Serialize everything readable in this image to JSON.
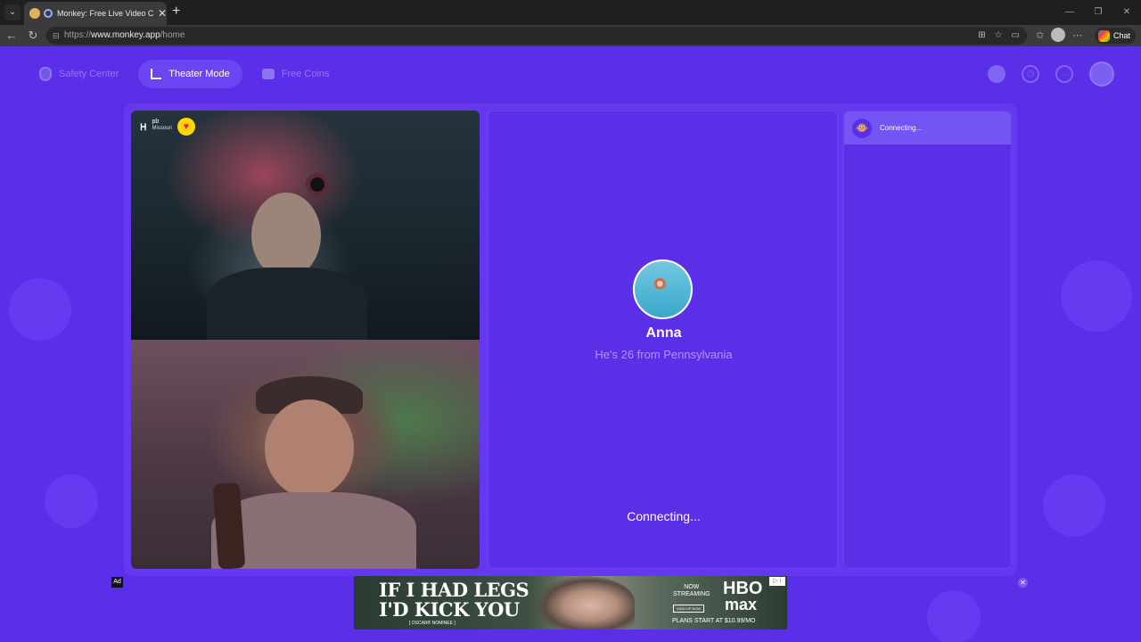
{
  "browser": {
    "tab_title": "Monkey: Free Live Video Chat",
    "url_scheme": "https://",
    "url_host": "www.monkey.app",
    "url_path": "/home",
    "chat_label": "Chat"
  },
  "nav": {
    "safety_center": "Safety Center",
    "theater_mode": "Theater Mode",
    "free_coins": "Free Coins"
  },
  "camera_user": {
    "logo": "ᕼ",
    "name": "pb",
    "location": "Missouri"
  },
  "match": {
    "name": "Anna",
    "info": "He's 26 from Pennsylvania",
    "status": "Connecting..."
  },
  "queue": {
    "status": "Connecting..."
  },
  "ad": {
    "label": "Ad",
    "headline_1": "IF I HAD LEGS",
    "headline_2": "I'D KICK YOU",
    "sub": "[ OSCAR® NOMINEE ]",
    "now_1": "NOW",
    "now_2": "STREAMING",
    "signup": "SIGN UP NOW",
    "brand_1": "HBO",
    "brand_2": "max",
    "plans": "PLANS START AT $10.99/MO"
  },
  "colors": {
    "app_bg": "#5b2ee8",
    "active_pill": "#6c45f2",
    "accent_muted": "#a99af5"
  }
}
